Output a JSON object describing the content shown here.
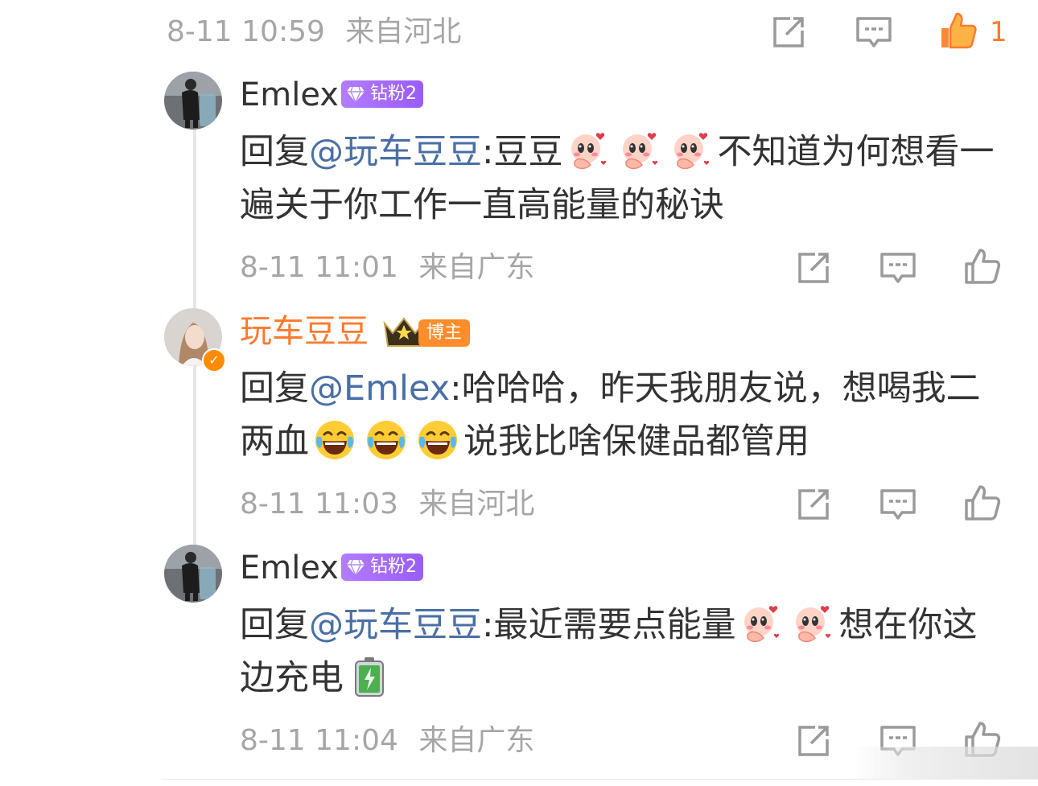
{
  "top_comment_meta": {
    "time": "8-11 10:59",
    "location": "来自河北",
    "like_count": "1"
  },
  "replies": [
    {
      "username": "Emlex",
      "badge": "钻粉2",
      "prefix": "回复",
      "mention": "@玩车豆豆",
      "text_before_emoji": ":豆豆",
      "text_after_emoji": "不知道为何想看一遍关于你工作一直高能量的秘诀",
      "emoji": [
        "blush-emoji",
        "blush-emoji",
        "blush-emoji"
      ],
      "time": "8-11 11:01",
      "location": "来自广东"
    },
    {
      "username": "玩车豆豆",
      "badge": "博主",
      "prefix": "回复",
      "mention": "@Emlex",
      "text_before_emoji": ":哈哈哈，昨天我朋友说，想喝我二两血",
      "text_after_emoji": "说我比啥保健品都管用",
      "emoji": [
        "laugh-cry-emoji",
        "laugh-cry-emoji",
        "laugh-cry-emoji"
      ],
      "time": "8-11 11:03",
      "location": "来自河北"
    },
    {
      "username": "Emlex",
      "badge": "钻粉2",
      "prefix": "回复",
      "mention": "@玩车豆豆",
      "text_before_emoji": ":最近需要点能量",
      "text_after_emoji": "想在你这边充电",
      "emoji": [
        "blush-emoji",
        "blush-emoji",
        "battery-emoji"
      ],
      "time": "8-11 11:04",
      "location": "来自广东"
    }
  ],
  "icons": {
    "share": "share-icon",
    "comment": "comment-icon",
    "like": "like-icon",
    "like_active": "liked-icon"
  },
  "colors": {
    "accent_orange": "#ff7a2e",
    "mention_blue": "#4a6fa5",
    "meta_gray": "#a6a6a6",
    "fan_badge_purple": "#a66cff"
  }
}
